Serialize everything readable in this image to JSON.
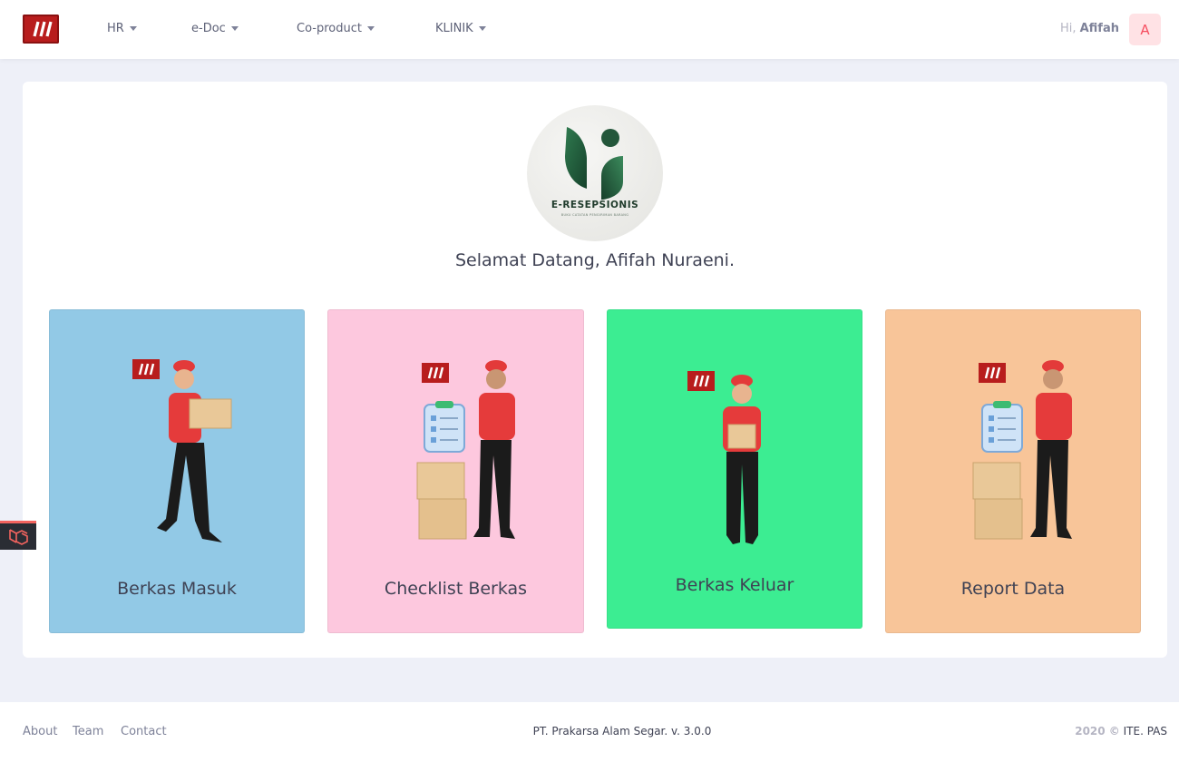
{
  "header": {
    "nav": [
      {
        "label": "HR"
      },
      {
        "label": "e-Doc"
      },
      {
        "label": "Co-product"
      },
      {
        "label": "KLINIK"
      }
    ],
    "greeting_prefix": "Hi,",
    "user_name": "Afifah",
    "avatar_initial": "A"
  },
  "brand": {
    "title": "E-RESEPSIONIS",
    "subtitle": "BUKU CATATAN PENGIRIMAN BARANG"
  },
  "welcome_text": "Selamat Datang, Afifah Nuraeni.",
  "tiles": [
    {
      "label": "Berkas Masuk",
      "color": "#92c9e6"
    },
    {
      "label": "Checklist Berkas",
      "color": "#fdc8de"
    },
    {
      "label": "Berkas Keluar",
      "color": "#3ced92"
    },
    {
      "label": "Report Data",
      "color": "#f8c599"
    }
  ],
  "footer": {
    "links": [
      {
        "label": "About"
      },
      {
        "label": "Team"
      },
      {
        "label": "Contact"
      }
    ],
    "center": "PT. Prakarsa Alam Segar. v. 3.0.0",
    "year": "2020 ©",
    "company": "ITE. PAS"
  },
  "colors": {
    "accent_red": "#b81d1d",
    "avatar_bg": "#ffe2e5",
    "avatar_fg": "#f64e60",
    "brand_green": "#1f5a3b"
  }
}
